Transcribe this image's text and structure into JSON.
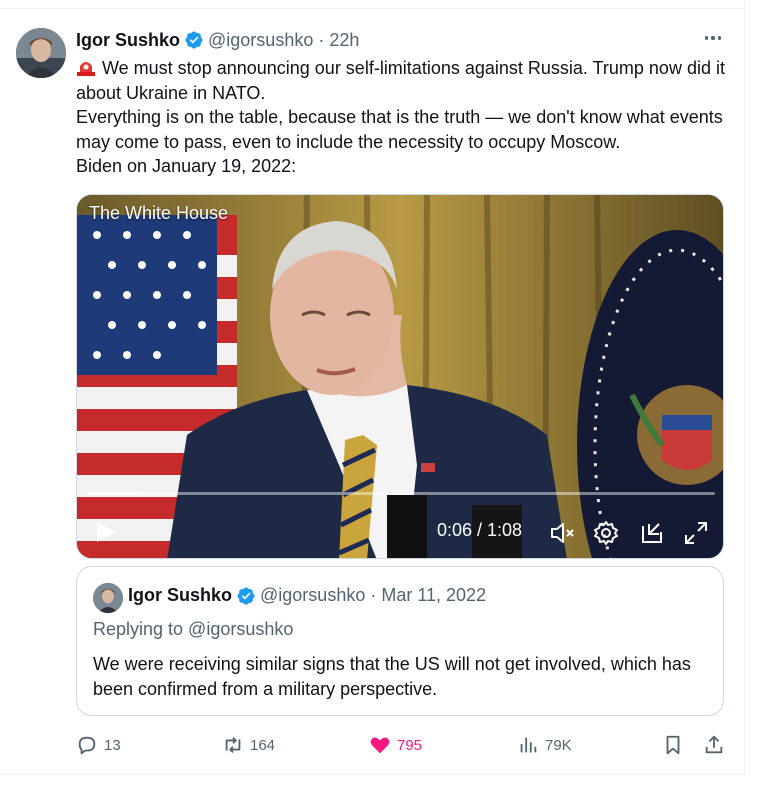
{
  "tweet": {
    "author": {
      "display_name": "Igor Sushko",
      "handle": "@igorsushko",
      "verified": true
    },
    "separator": "·",
    "time": "22h",
    "text_line1": "We must stop announcing our self-limitations against Russia. Trump now did it about Ukraine in NATO.",
    "text_line2": "Everything is on the table, because that is the truth — we don't know what events may come to pass, even to include the necessity to occupy Moscow.",
    "text_line3": "Biden on January 19, 2022:",
    "emoji_icon": "rotating-light-icon"
  },
  "media": {
    "source_label": "The White House",
    "time_display": "0:06 / 1:08",
    "progress_fraction": 0.088,
    "controls": [
      "play-icon",
      "volume-muted-icon",
      "settings-icon",
      "pip-icon",
      "fullscreen-icon"
    ]
  },
  "quoted_tweet": {
    "display_name": "Igor Sushko",
    "handle": "@igorsushko",
    "separator": "·",
    "date": "Mar 11, 2022",
    "replying_to": "Replying to @igorsushko",
    "text": "We were receiving similar signs that the US will not get involved, which has been confirmed from a military perspective."
  },
  "actions": {
    "replies": "13",
    "reposts": "164",
    "likes": "795",
    "views": "79K",
    "liked": true
  },
  "colors": {
    "verified_blue": "#1d9bf0",
    "like_pink": "#f91880",
    "secondary_text": "#536471",
    "border": "#cfd9de"
  }
}
